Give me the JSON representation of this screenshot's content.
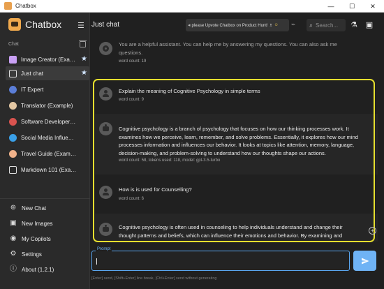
{
  "window": {
    "title": "Chatbox",
    "controls": [
      "—",
      "☐",
      "✕"
    ]
  },
  "sidebar": {
    "brand": "Chatbox",
    "section_label": "Chat",
    "items": [
      {
        "label": "Image Creator (Exam...",
        "icon": "image-icon",
        "starred": true
      },
      {
        "label": "Just chat",
        "icon": "chat-bubble-icon",
        "starred": true,
        "active": true
      },
      {
        "label": "IT Expert",
        "icon": "robot-avatar-icon",
        "starred": false
      },
      {
        "label": "Translator (Example)",
        "icon": "translator-avatar-icon",
        "starred": false
      },
      {
        "label": "Software Developer (Ex...",
        "icon": "developer-avatar-icon",
        "starred": false
      },
      {
        "label": "Social Media Influencer ...",
        "icon": "bird-avatar-icon",
        "starred": false
      },
      {
        "label": "Travel Guide (Example)",
        "icon": "travel-avatar-icon",
        "starred": false
      },
      {
        "label": "Markdown 101 (Example)",
        "icon": "chat-bubble-icon",
        "starred": false
      }
    ],
    "bottom_items": [
      {
        "label": "New Chat",
        "icon": "plus-circle-icon"
      },
      {
        "label": "New Images",
        "icon": "image-icon"
      },
      {
        "label": "My Copilots",
        "icon": "robot-icon"
      },
      {
        "label": "Settings",
        "icon": "gear-icon"
      },
      {
        "label": "About (1.2.1)",
        "icon": "info-icon"
      }
    ]
  },
  "header": {
    "chat_title": "Just chat",
    "promo_text": "please Upvote Chatbox on Product Hunt! ♗",
    "search_placeholder": "Search..."
  },
  "messages": [
    {
      "role": "system",
      "text": "You are a helpful assistant. You can help me by answering my questions. You can also ask me questions.",
      "meta": "word count: 19"
    },
    {
      "role": "user",
      "text": "Explain the meaning of Cognitive Psychology in simple terms",
      "meta": "word count: 9"
    },
    {
      "role": "assistant",
      "text": "Cognitive psychology is a branch of psychology that focuses on how our thinking processes work. It examines how we perceive, learn, remember, and solve problems. Essentially, it explores how our mind processes information and influences our behavior. It looks at topics like attention, memory, language, decision-making, and problem-solving to understand how our thoughts shape our actions.",
      "meta": "word count: 58, tokens used: 118, model: gpt-3.5-turbo"
    },
    {
      "role": "user",
      "text": "How is is used for Counselling?",
      "meta": "word count: 6"
    },
    {
      "role": "assistant",
      "text": "Cognitive psychology is often used in counseling to help individuals understand and change their thought patterns and beliefs, which can influence their emotions and behavior. By examining and",
      "meta": ""
    }
  ],
  "input": {
    "label": "Prompt",
    "value": "",
    "hint": "[Enter] send, [Shift+Enter] line break, [Ctrl+Enter] send without generating"
  },
  "colors": {
    "accent": "#6fb3f5",
    "highlight": "#e6df2e",
    "brand": "#f0a94d"
  }
}
